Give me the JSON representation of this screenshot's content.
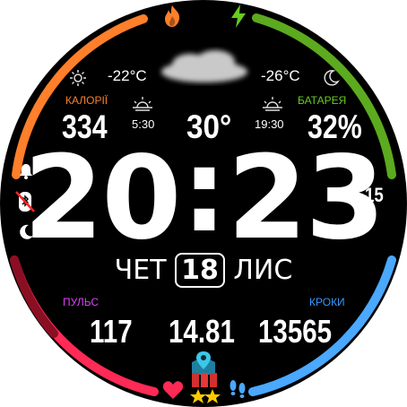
{
  "colors": {
    "calories": "#ff7f2a",
    "battery": "#66cc22",
    "heart": "#ff2a55",
    "steps": "#4aa8ff",
    "pulse_label": "#e040fb",
    "steps_label": "#3399ff"
  },
  "weather": {
    "temp_day": "-22°C",
    "temp_night": "-26°C",
    "current_temp": "30°",
    "sunrise": "5:30",
    "sunset": "19:30",
    "day_icon": "sun-icon",
    "night_icon": "moon-icon",
    "cloud_icon": "cloud-icon"
  },
  "calories": {
    "label": "КАЛОРІЇ",
    "value": "334",
    "icon": "fire-icon"
  },
  "battery": {
    "label": "БАТАРЕЯ",
    "value": "32%",
    "icon": "lightning-icon"
  },
  "time": {
    "hours": "20",
    "separator": ":",
    "minutes": "23",
    "seconds": "15"
  },
  "date": {
    "weekday": "ЧЕТ",
    "day": "18",
    "month": "ЛИС"
  },
  "pulse": {
    "label": "ПУЛЬС",
    "value": "117",
    "icon": "heart-icon"
  },
  "distance": {
    "value": "14.81",
    "icon": "map-pin-icon"
  },
  "steps": {
    "label": "КРОКИ",
    "value": "13565",
    "icon": "footprints-icon"
  },
  "status_icons": [
    "bell-icon",
    "bluetooth-off-icon",
    "moon-icon"
  ]
}
